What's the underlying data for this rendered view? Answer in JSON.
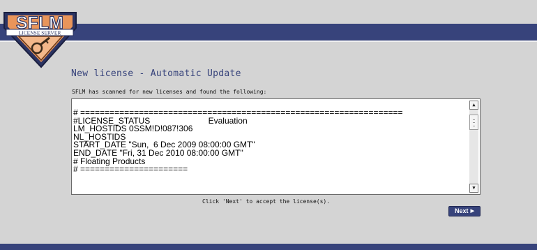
{
  "logo": {
    "text": "SFLM",
    "subtext": "LICENSE SERVER"
  },
  "page": {
    "title": "New license - Automatic Update",
    "subtitle": "SFLM has scanned for new licenses and found the following:",
    "instruction": "Click 'Next' to accept the license(s)."
  },
  "license_text": "# ==================================================================\n#LICENSE_STATUS                         Evaluation\nLM_HOSTIDS 0SSM!D!087!306\nNL_HOSTIDS\nSTART_DATE \"Sun,  6 Dec 2009 08:00:00 GMT\"\nEND_DATE \"Fri, 31 Dec 2010 08:00:00 GMT\"\n# Floating Products\n# ======================",
  "buttons": {
    "next_label": "Next"
  },
  "icons": {
    "scroll_up": "arrow-up-icon",
    "scroll_down": "arrow-down-icon",
    "next_arrow": "play-arrow-icon"
  },
  "colors": {
    "brand_blue": "#37437b",
    "logo_orange": "#e9955a",
    "background": "#d4d4d4"
  }
}
